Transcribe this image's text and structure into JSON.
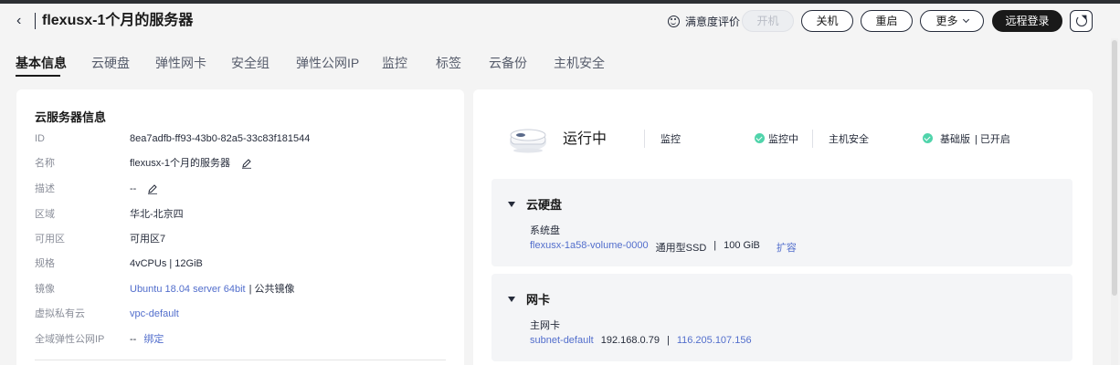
{
  "header": {
    "title": "flexusx-1个月的服务器",
    "satisfaction": "满意度评价",
    "buttons": {
      "start": "开机",
      "stop": "关机",
      "reboot": "重启",
      "more": "更多",
      "remote": "远程登录"
    }
  },
  "tabs": [
    {
      "label": "基本信息",
      "active": true
    },
    {
      "label": "云硬盘"
    },
    {
      "label": "弹性网卡"
    },
    {
      "label": "安全组"
    },
    {
      "label": "弹性公网IP"
    },
    {
      "label": "监控"
    },
    {
      "label": "标签"
    },
    {
      "label": "云备份"
    },
    {
      "label": "主机安全"
    }
  ],
  "server_info": {
    "title": "云服务器信息",
    "rows": [
      {
        "label": "ID",
        "value": "8ea7adfb-ff93-43b0-82a5-33c83f181544"
      },
      {
        "label": "名称",
        "value": "flexusx-1个月的服务器"
      },
      {
        "label": "描述",
        "value": "--"
      },
      {
        "label": "区域",
        "value": "华北-北京四"
      },
      {
        "label": "可用区",
        "value": "可用区7"
      },
      {
        "label": "规格",
        "value": "4vCPUs | 12GiB"
      },
      {
        "label": "镜像",
        "value_link": "Ubuntu 18.04 server 64bit",
        "value_suffix": "| 公共镜像"
      },
      {
        "label": "虚拟私有云",
        "value_link": "vpc-default"
      },
      {
        "label": "全域弹性公网IP",
        "value": "--",
        "value_link": "绑定"
      }
    ]
  },
  "status": {
    "state": "运行中",
    "monitor_label": "监控",
    "monitor_value": "监控中",
    "hss_label": "主机安全",
    "hss_edition": "基础版",
    "hss_state": "| 已开启",
    "ok_color": "#50d4ab"
  },
  "disk_panel": {
    "title": "云硬盘",
    "sub": "系统盘",
    "volume": "flexusx-1a58-volume-0000",
    "type": "通用型SSD",
    "sep": "|",
    "size": "100 GiB",
    "expand": "扩容"
  },
  "nic_panel": {
    "title": "网卡",
    "sub": "主网卡",
    "subnet": "subnet-default",
    "private_ip": "192.168.0.79",
    "sep": "|",
    "public_ip": "116.205.107.156"
  },
  "colors": {
    "link": "#526ecc",
    "primary_button": "#191919"
  }
}
